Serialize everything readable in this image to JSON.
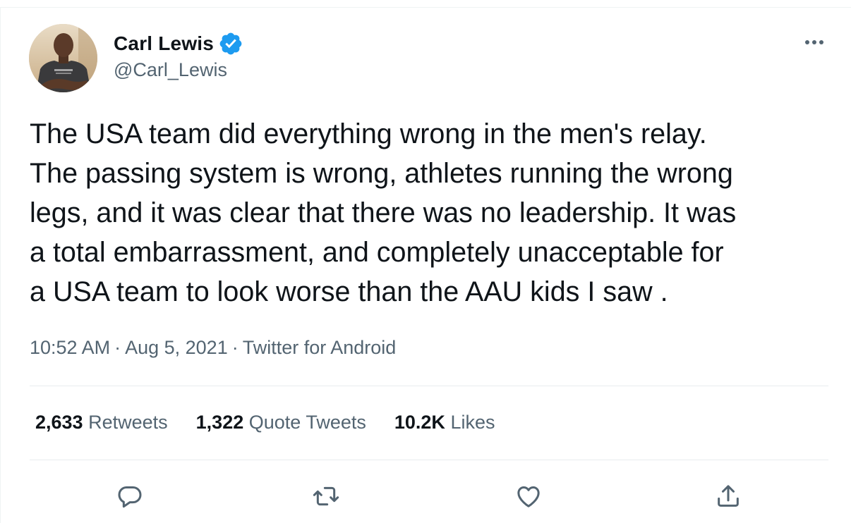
{
  "author": {
    "display_name": "Carl Lewis",
    "handle": "@Carl_Lewis",
    "verified": true
  },
  "tweet": {
    "text": "The USA team did everything wrong in the men's relay.\nThe passing system is wrong, athletes running the wrong\nlegs, and it was clear that there was no leadership. It was\na total embarrassment, and completely unacceptable for\na USA team to look worse than the AAU kids I saw .",
    "time": "10:52 AM",
    "date": "Aug 5, 2021",
    "source": "Twitter for Android",
    "separator": "·"
  },
  "stats": {
    "retweets": {
      "count": "2,633",
      "label": "Retweets"
    },
    "quote_tweets": {
      "count": "1,322",
      "label": "Quote Tweets"
    },
    "likes": {
      "count": "10.2K",
      "label": "Likes"
    }
  },
  "actions": [
    {
      "name": "reply-icon"
    },
    {
      "name": "retweet-icon"
    },
    {
      "name": "like-icon"
    },
    {
      "name": "share-icon"
    }
  ],
  "colors": {
    "text": "#0f1419",
    "secondary": "#536471",
    "verified": "#1d9bf0",
    "divider": "#e8ecee"
  }
}
